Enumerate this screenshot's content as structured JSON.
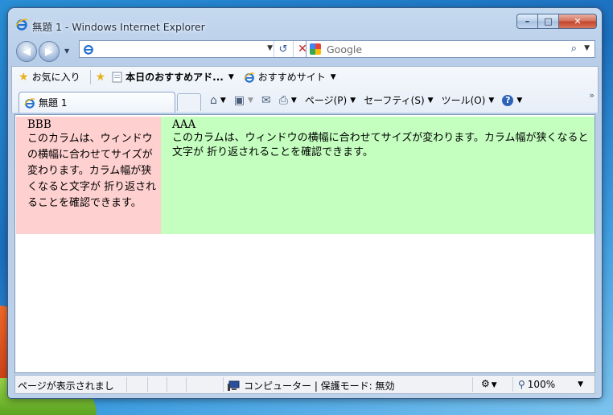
{
  "window": {
    "title": "無題 1 - Windows Internet Explorer",
    "controls": {
      "minimize": "–",
      "maximize": "□",
      "close": "✕"
    }
  },
  "address_bar": {
    "url": "",
    "refresh_icon": "↺",
    "stop_icon": "✕"
  },
  "search_bar": {
    "placeholder": "Google",
    "go_icon": "⌕"
  },
  "favorites_bar": {
    "favorites_label": "お気に入り",
    "suggested_label": "本日のおすすめアド...",
    "sites_label": "おすすめサイト"
  },
  "tab": {
    "label": "無題 1"
  },
  "command_bar": {
    "page_label": "ページ(P)",
    "safety_label": "セーフティ(S)",
    "tools_label": "ツール(O)",
    "help_icon": "?",
    "overflow": "»"
  },
  "page": {
    "left_column": {
      "title": "BBB",
      "text": "このカラムは、ウィンドウの横幅に合わせてサイズが変わります。カラム幅が狭くなると文字が 折り返されることを確認できます。"
    },
    "right_column": {
      "title": "AAA",
      "text": "このカラムは、ウィンドウの横幅に合わせてサイズが変わります。カラム幅が狭くなると文字が 折り返されることを確認できます。"
    },
    "colors": {
      "left_bg": "#ffd0d0",
      "right_bg": "#c4ffc0"
    }
  },
  "status_bar": {
    "status_text": "ページが表示されまし",
    "zone_text": "コンピューター | 保護モード: 無効",
    "zoom": "100%"
  }
}
